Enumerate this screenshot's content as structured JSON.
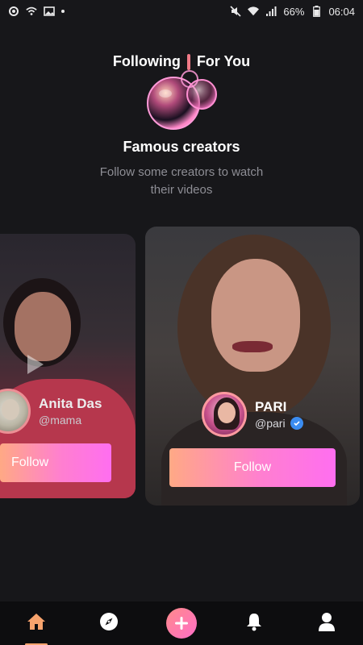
{
  "status_bar": {
    "battery": "66%",
    "time": "06:04"
  },
  "header": {
    "tab_following": "Following",
    "tab_for_you": "For You"
  },
  "intro": {
    "title": "Famous creators",
    "subtitle": "Follow some creators to watch their videos"
  },
  "creators": [
    {
      "name": "Anita Das",
      "handle": "@mama",
      "verified": false,
      "follow_label": "Follow"
    },
    {
      "name": "PARI",
      "handle": "@pari",
      "verified": true,
      "follow_label": "Follow"
    }
  ],
  "bottom_nav": {
    "items": [
      "home-icon",
      "compass-icon",
      "plus-icon",
      "bell-icon",
      "profile-icon"
    ],
    "active": "home-icon"
  },
  "colors": {
    "accent_gradient_start": "#ffa985",
    "accent_gradient_end": "#ff6ef0",
    "active_nav": "#f7a36d",
    "verified": "#3b8cf0"
  }
}
